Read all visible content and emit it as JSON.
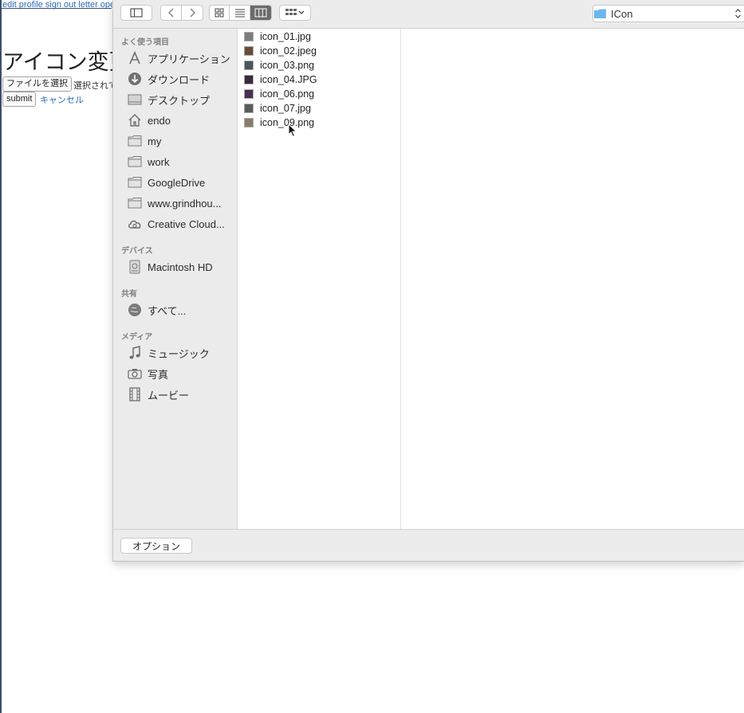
{
  "page": {
    "nav_links": [
      "edit profile",
      "sign out",
      "letter",
      "open"
    ],
    "title": "アイコン変更",
    "file_button_label": "ファイルを選択",
    "no_file_text": "選択されていません",
    "submit_label": "submit",
    "cancel_label": "キャンセル"
  },
  "dialog": {
    "location": "ICon",
    "sidebar": {
      "sections": [
        {
          "header": "よく使う項目",
          "items": [
            {
              "label": "アプリケーション",
              "icon": "applications-icon"
            },
            {
              "label": "ダウンロード",
              "icon": "downloads-icon"
            },
            {
              "label": "デスクトップ",
              "icon": "desktop-icon"
            },
            {
              "label": "endo",
              "icon": "home-icon"
            },
            {
              "label": "my",
              "icon": "folder-icon"
            },
            {
              "label": "work",
              "icon": "folder-icon"
            },
            {
              "label": "GoogleDrive",
              "icon": "folder-icon"
            },
            {
              "label": "www.grindhou...",
              "icon": "folder-icon"
            },
            {
              "label": "Creative Cloud...",
              "icon": "creative-cloud-icon"
            }
          ]
        },
        {
          "header": "デバイス",
          "items": [
            {
              "label": "Macintosh HD",
              "icon": "hard-drive-icon"
            }
          ]
        },
        {
          "header": "共有",
          "items": [
            {
              "label": "すべて...",
              "icon": "network-icon"
            }
          ]
        },
        {
          "header": "メディア",
          "items": [
            {
              "label": "ミュージック",
              "icon": "music-icon"
            },
            {
              "label": "写真",
              "icon": "camera-icon"
            },
            {
              "label": "ムービー",
              "icon": "film-icon"
            }
          ]
        }
      ]
    },
    "files": [
      "icon_01.jpg",
      "icon_02.jpeg",
      "icon_03.png",
      "icon_04.JPG",
      "icon_06.png",
      "icon_07.jpg",
      "icon_09.png"
    ],
    "options_label": "オプション",
    "colors": {
      "folder_blue": "#6cb7ee",
      "active_view": "#6b6b6b",
      "link": "#2a6db5"
    }
  }
}
